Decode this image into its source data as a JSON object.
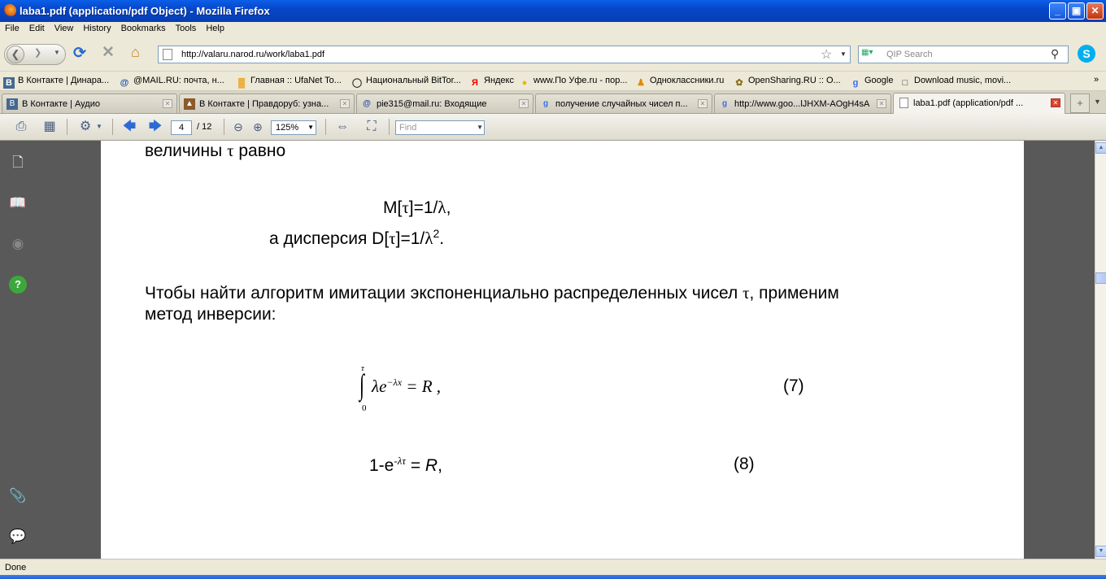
{
  "window": {
    "title": "laba1.pdf (application/pdf Object) - Mozilla Firefox",
    "minimize": "_",
    "maximize": "▣",
    "close": "✕"
  },
  "menu": [
    "File",
    "Edit",
    "View",
    "History",
    "Bookmarks",
    "Tools",
    "Help"
  ],
  "nav": {
    "url": "http://valaru.narod.ru/work/laba1.pdf",
    "search_placeholder": "QIP Search"
  },
  "bookmarks": [
    {
      "icon": "vk-icon",
      "label": "В Контакте | Динара..."
    },
    {
      "icon": "at-icon",
      "label": "@MAIL.RU: почта, н..."
    },
    {
      "icon": "ufanet-icon",
      "label": "Главная :: UfaNet To..."
    },
    {
      "icon": "bittorrent-icon",
      "label": "Национальный BitTor..."
    },
    {
      "icon": "yandex-icon",
      "label": "Яндекс"
    },
    {
      "icon": "ufe-icon",
      "label": "www.По Уфе.ru - пор..."
    },
    {
      "icon": "odnoklassniki-icon",
      "label": "Одноклассники.ru"
    },
    {
      "icon": "opensharing-icon",
      "label": "OpenSharing.RU :: O..."
    },
    {
      "icon": "google-icon",
      "label": "Google"
    },
    {
      "icon": "music-icon",
      "label": "Download music, movi..."
    }
  ],
  "tabs": [
    {
      "icon": "vk-icon",
      "label": "В Контакте | Аудио",
      "active": false
    },
    {
      "icon": "vk-icon",
      "label": "В Контакте | Правдоруб: узна...",
      "active": false
    },
    {
      "icon": "at-icon",
      "label": "pie315@mail.ru: Входящие",
      "active": false
    },
    {
      "icon": "google-icon",
      "label": "получение случайных чисел п...",
      "active": false
    },
    {
      "icon": "google-icon",
      "label": "http://www.goo...lJHXM-AOgH4sA",
      "active": false
    },
    {
      "icon": "page-icon",
      "label": "laba1.pdf (application/pdf ...",
      "active": true
    }
  ],
  "pdf_toolbar": {
    "page_current": "4",
    "page_total": "/  12",
    "zoom": "125%",
    "find_placeholder": "Find"
  },
  "document": {
    "line1_text": "величины ",
    "line1_sym": "τ",
    "line1_end": " равно",
    "eq_mean_a": "M[",
    "eq_mean_sym": "τ",
    "eq_mean_b": "]=1/",
    "eq_mean_lambda": "λ",
    "eq_mean_end": ",",
    "eq_disp_prefix": "а дисперсия  D[",
    "eq_disp_sym": "τ",
    "eq_disp_b": "]=1/",
    "eq_disp_lambda": "λ",
    "eq_disp_exp": "2",
    "eq_disp_end": ".",
    "para_line1": "Чтобы  найти  алгоритм  имитации  экспоненциально  распределенных  чисел  ",
    "para_sym": "τ",
    "para_line1_end": ",  применим",
    "para_line2": "метод инверсии:",
    "int_upper": "τ",
    "int_lower": "0",
    "int_body": "λe",
    "int_exp": "−λx",
    "int_rhs": " = R ,",
    "eq7_label": "(7)",
    "eq8_lhs": "1-e",
    "eq8_exp": "-λτ",
    "eq8_eq": " = ",
    "eq8_R": "R",
    "eq8_end": ",",
    "eq8_label": "(8)"
  },
  "status": "Done"
}
